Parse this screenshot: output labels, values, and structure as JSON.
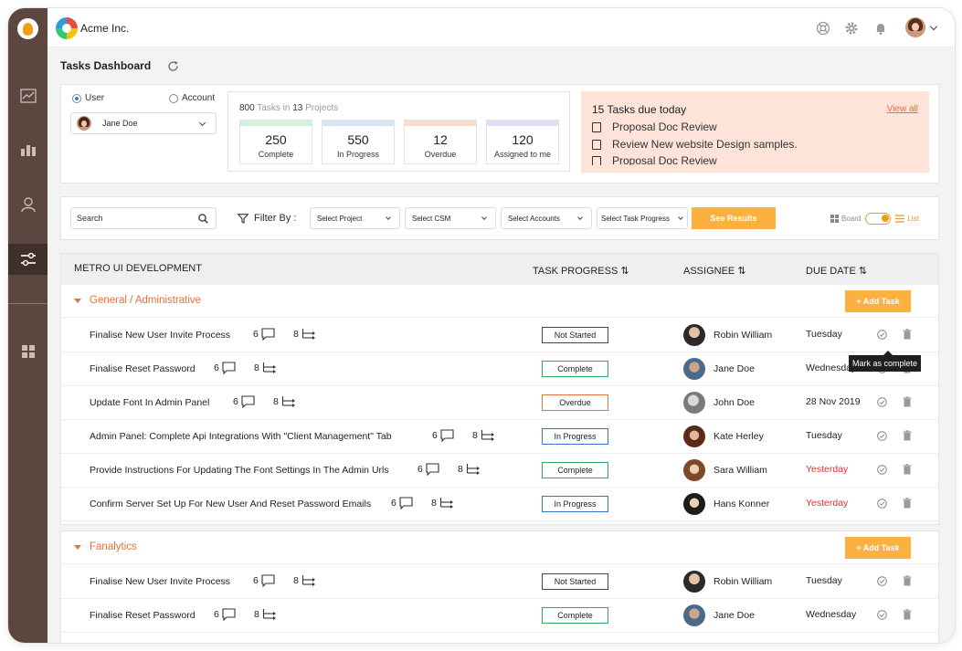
{
  "app": {
    "brand": "Acme Inc.",
    "page_title": "Tasks Dashboard"
  },
  "sidebar": {
    "items": [
      {
        "name": "analytics-icon"
      },
      {
        "name": "reports-icon"
      },
      {
        "name": "users-icon"
      },
      {
        "name": "tasks-icon",
        "active": true
      },
      {
        "name": "apps-icon"
      }
    ]
  },
  "topbar": {
    "icons": [
      "support-icon",
      "gear-icon",
      "bell-icon"
    ]
  },
  "scope": {
    "user_label": "User",
    "account_label": "Account",
    "selected": "User",
    "selected_user": "Jane Doe"
  },
  "summary": {
    "total_tasks": "800",
    "tasks_word": "Tasks in",
    "total_projects": "13",
    "projects_word": "Projects",
    "stats": [
      {
        "value": "250",
        "label": "Complete",
        "color": "#d4f1dd"
      },
      {
        "value": "550",
        "label": "In Progress",
        "color": "#d6e6f7"
      },
      {
        "value": "12",
        "label": "Overdue",
        "color": "#fbd9cc"
      },
      {
        "value": "120",
        "label": "Assigned to me",
        "color": "#e3dcf5"
      }
    ]
  },
  "due_today": {
    "title": "15 Tasks due today",
    "view_all": "View all",
    "items": [
      "Proposal Doc Review",
      "Review New website Design samples.",
      "Proposal Doc Review"
    ]
  },
  "filters": {
    "search_placeholder": "Search",
    "filter_by": "Filter By :",
    "project": "Select Project",
    "csm": "Select CSM",
    "accounts": "Select Accounts",
    "progress": "Select Task Progress",
    "see_results": "See Results",
    "board": "Board",
    "list": "List"
  },
  "table": {
    "columns": {
      "project": "METRO UI DEVELOPMENT",
      "progress": "TASK PROGRESS",
      "assignee": "ASSIGNEE",
      "due": "DUE DATE"
    },
    "add_task": "+ Add Task",
    "tooltip": "Mark as complete",
    "groups": [
      {
        "title": "General / Administrative",
        "rows": [
          {
            "task": "Finalise New User Invite Process",
            "comments": "6",
            "subtasks": "8",
            "status": "Not Started",
            "assignee": "Robin William",
            "due": "Tuesday",
            "overdue": false
          },
          {
            "task": "Finalise Reset Password",
            "comments": "6",
            "subtasks": "8",
            "status": "Complete",
            "assignee": "Jane Doe",
            "due": "Wednesday",
            "overdue": false
          },
          {
            "task": "Update Font In Admin Panel",
            "comments": "6",
            "subtasks": "8",
            "status": "Overdue",
            "assignee": "John Doe",
            "due": "28 Nov 2019",
            "overdue": false
          },
          {
            "task": "Admin Panel: Complete Api Integrations With \"Client Management\" Tab",
            "comments": "6",
            "subtasks": "8",
            "status": "In Progress",
            "assignee": "Kate Herley",
            "due": "Tuesday",
            "overdue": false
          },
          {
            "task": "Provide Instructions For Updating The Font Settings In The Admin Urls",
            "comments": "6",
            "subtasks": "8",
            "status": "Complete",
            "assignee": "Sara William",
            "due": "Yesterday",
            "overdue": true
          },
          {
            "task": "Confirm Server Set Up For New User And Reset Password Emails",
            "comments": "6",
            "subtasks": "8",
            "status": "In Progress",
            "assignee": "Hans Konner",
            "due": "Yesterday",
            "overdue": true
          }
        ]
      },
      {
        "title": "Fanalytics",
        "rows": [
          {
            "task": "Finalise New User Invite Process",
            "comments": "6",
            "subtasks": "8",
            "status": "Not Started",
            "assignee": "Robin William",
            "due": "Tuesday",
            "overdue": false
          },
          {
            "task": "Finalise Reset Password",
            "comments": "6",
            "subtasks": "8",
            "status": "Complete",
            "assignee": "Jane Doe",
            "due": "Wednesday",
            "overdue": false
          }
        ]
      }
    ]
  },
  "colors": {
    "sidebar": "#5b4740",
    "accent": "#fbb040",
    "group_title": "#e8703a",
    "due_card": "#fde3d8",
    "overdue_text": "#e03131"
  }
}
